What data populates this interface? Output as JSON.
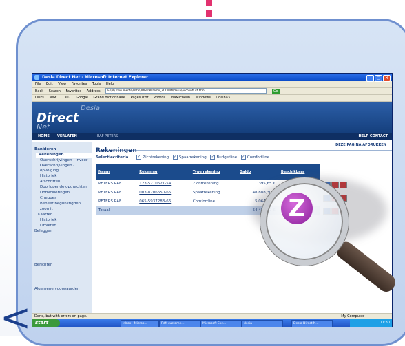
{
  "browser": {
    "title": "Desia Direct Net - Microsoft Internet Explorer",
    "menu": [
      "File",
      "Edit",
      "View",
      "Favorites",
      "Tools",
      "Help"
    ],
    "toolbar": [
      "Back",
      "Search",
      "Favorites"
    ],
    "address_label": "Address",
    "address_value": "E:\\My Documents\\Data\\PDG\\DP\\Demo_ZOOMIN\\desia\\AccountList.html",
    "go": "Go",
    "links_label": "Links",
    "links": [
      "New",
      "1307",
      "Google",
      "Grand dictionnaire",
      "Pages d'or",
      "Photos",
      "ViaMichelin",
      "Windows",
      "Coaina3"
    ]
  },
  "site": {
    "logo_top": "Desia",
    "logo_main": "Direct",
    "logo_sub": "Net",
    "nav": [
      "HOME",
      "VERLATEN"
    ],
    "user": "RAF PETERS",
    "nav_right": [
      "HELP",
      "CONTACT"
    ]
  },
  "sidebar": {
    "items": [
      "Bankieren",
      "Rekeningen",
      "Overschrijvingen - invoer",
      "Overschrijvingen - opvolging",
      "Historiek",
      "Afschriften",
      "Doorlopende opdrachten",
      "Domiciliëringen",
      "Cheques",
      "Beheer begunstigden",
      "zoomit",
      "Kaarten",
      "Historiek",
      "Limieten",
      "Beleggen",
      "Berichten",
      "Algemene voorwaarden"
    ]
  },
  "main": {
    "title": "Rekeningen",
    "print_link": "DEZE PAGINA AFDRUKKEN",
    "criteria_label": "Selectiecriteria:",
    "criteria": [
      "Zichtrekening",
      "Spaarrekening",
      "Budgetline",
      "Comfortline"
    ],
    "columns": [
      "Naam",
      "Rekening",
      "Type rekening",
      "Saldo",
      "Beschikbaar"
    ],
    "rows": [
      {
        "naam": "PETERS RAF",
        "rekening": "123-5210621-54",
        "type": "Zichtrekening",
        "saldo": "395,65 €"
      },
      {
        "naam": "PETERS RAF",
        "rekening": "003-8206650-65",
        "type": "Spaarrekening",
        "saldo": "48.888,30 €"
      },
      {
        "naam": "PETERS RAF",
        "rekening": "065-5937283-66",
        "type": "Comfortline",
        "saldo": "5.064,89 €"
      }
    ],
    "total_label": "Totaal",
    "total": "54.453,32 €"
  },
  "statusbar": {
    "left": "Done, but with errors on page.",
    "right": "My Computer"
  },
  "taskbar": {
    "start": "start",
    "tasks": [
      "Inbox - Micros...",
      "Pdf: custome...",
      "Microsoft Exc...",
      "desia",
      "Desia Direct N..."
    ],
    "clock": "11:30"
  },
  "badge_letter": "Z",
  "colors": {
    "accent": "#e2326f",
    "brand": "#1b4b8c",
    "zoomit": "#a22db3"
  }
}
